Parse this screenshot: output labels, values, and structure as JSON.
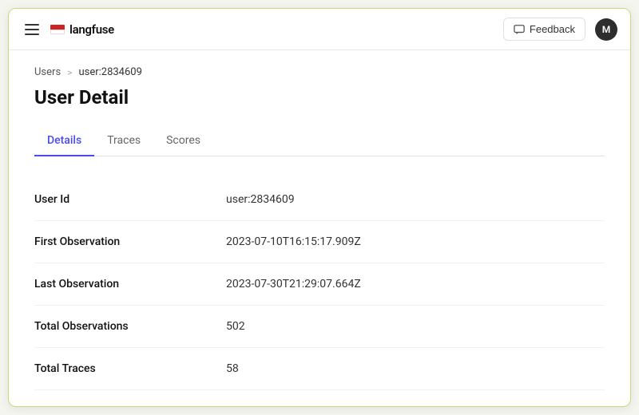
{
  "header": {
    "menu_label": "menu",
    "logo_text": "langfuse",
    "feedback_label": "Feedback",
    "avatar_label": "M"
  },
  "breadcrumb": {
    "parent_label": "Users",
    "separator": ">",
    "current_label": "user:2834609"
  },
  "page": {
    "title": "User Detail"
  },
  "tabs": [
    {
      "label": "Details",
      "active": true
    },
    {
      "label": "Traces",
      "active": false
    },
    {
      "label": "Scores",
      "active": false
    }
  ],
  "details": [
    {
      "label": "User Id",
      "value": "user:2834609"
    },
    {
      "label": "First Observation",
      "value": "2023-07-10T16:15:17.909Z"
    },
    {
      "label": "Last Observation",
      "value": "2023-07-30T21:29:07.664Z"
    },
    {
      "label": "Total Observations",
      "value": "502"
    },
    {
      "label": "Total Traces",
      "value": "58"
    }
  ]
}
